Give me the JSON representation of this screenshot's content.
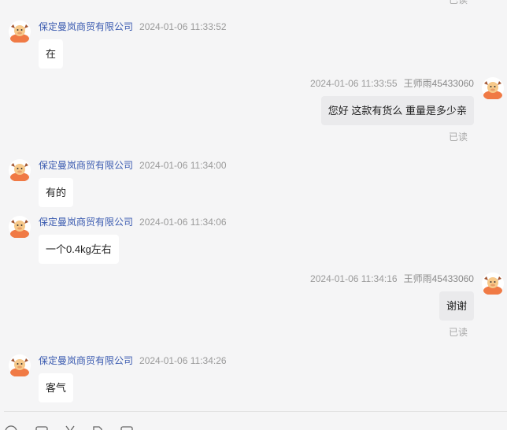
{
  "top_read": "已读",
  "messages": [
    {
      "side": "left",
      "sender": "保定曼岚商贸有限公司",
      "time": "2024-01-06 11:33:52",
      "text": "在"
    },
    {
      "side": "right",
      "sender": "王师雨45433060",
      "time": "2024-01-06 11:33:55",
      "text": "您好  这款有货么  重量是多少亲",
      "status": "已读"
    },
    {
      "side": "left",
      "sender": "保定曼岚商贸有限公司",
      "time": "2024-01-06 11:34:00",
      "text": "有的"
    },
    {
      "side": "left",
      "sender": "保定曼岚商贸有限公司",
      "time": "2024-01-06 11:34:06",
      "text": "一个0.4kg左右"
    },
    {
      "side": "right",
      "sender": "王师雨45433060",
      "time": "2024-01-06 11:34:16",
      "text": "谢谢",
      "status": "已读"
    },
    {
      "side": "left",
      "sender": "保定曼岚商贸有限公司",
      "time": "2024-01-06 11:34:26",
      "text": "客气"
    }
  ],
  "icons": {
    "avatar": "cartoon-bull-avatar-icon",
    "toolbar": [
      "emoji-icon",
      "image-icon",
      "scissors-icon",
      "file-icon",
      "more-icon"
    ]
  },
  "colors": {
    "sender_name": "#3b5bb0",
    "avatar_body": "#f07a45",
    "avatar_face": "#f7c98a",
    "background": "#f5f5f6"
  }
}
